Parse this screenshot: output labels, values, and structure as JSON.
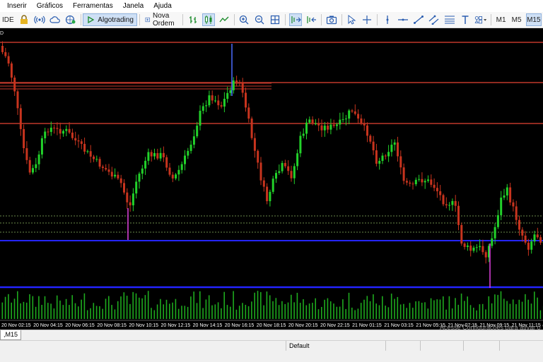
{
  "menu": {
    "items": [
      "Inserir",
      "Gráficos",
      "Ferramentas",
      "Janela",
      "Ajuda"
    ]
  },
  "toolbar": {
    "ide_label": "IDE",
    "algotrading_label": "Algotrading",
    "new_order_label": "Nova Ordem",
    "timeframes": [
      "M1",
      "M5",
      "M15"
    ]
  },
  "chart_tab": {
    "label": ",M15"
  },
  "status": {
    "profile": "Default"
  },
  "watermark": {
    "text": "Acesse Configurações para ativar o Windows."
  },
  "colors": {
    "background": "#000000",
    "bull": "#22d22a",
    "bear": "#c8341e",
    "level_line": "#c0392b",
    "blue_line": "#2424ff",
    "dotted_level": "#6a8a4a",
    "volume": "#1eaa1e"
  },
  "chart_data": {
    "type": "candlestick",
    "time_labels": [
      "20 Nov 02:15",
      "20 Nov 04:15",
      "20 Nov 06:15",
      "20 Nov 08:15",
      "20 Nov 10:15",
      "20 Nov 12:15",
      "20 Nov 14:15",
      "20 Nov 16:15",
      "20 Nov 18:15",
      "20 Nov 20:15",
      "20 Nov 22:15",
      "21 Nov 01:15",
      "21 Nov 03:15",
      "21 Nov 05:15",
      "21 Nov 07:15",
      "21 Nov 09:15",
      "21 Nov 11:15"
    ],
    "levels": [
      10,
      67,
      125
    ]
  }
}
